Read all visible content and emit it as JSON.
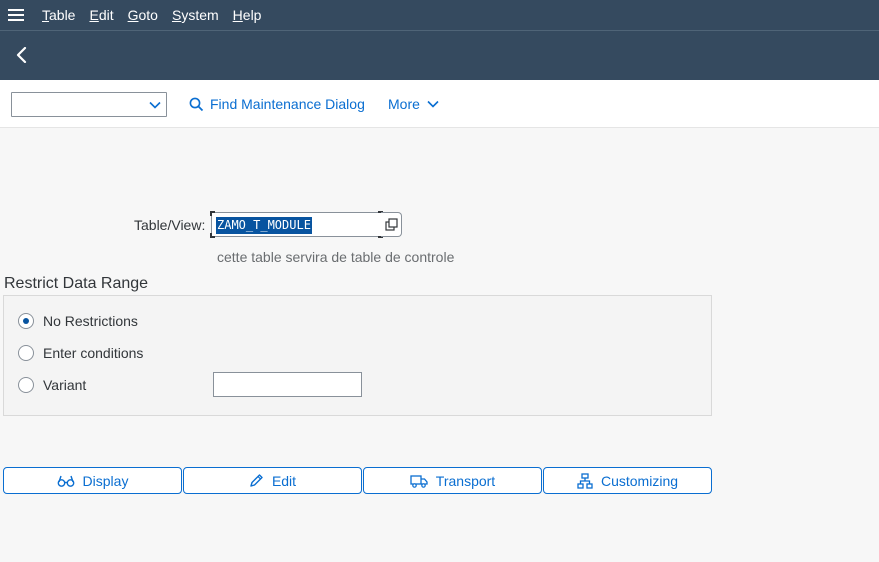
{
  "menu": {
    "items": [
      {
        "first": "T",
        "rest": "able"
      },
      {
        "first": "E",
        "rest": "dit"
      },
      {
        "first": "G",
        "rest": "oto"
      },
      {
        "first": "S",
        "rest": "ystem"
      },
      {
        "first": "H",
        "rest": "elp"
      }
    ]
  },
  "toolbar": {
    "dropdown_value": "",
    "find_label": "Find Maintenance Dialog",
    "more_label": "More"
  },
  "form": {
    "table_label": "Table/View:",
    "table_value": "ZAMO_T_MODULE",
    "table_description": "cette table servira de table de controle"
  },
  "restrict": {
    "title": "Restrict Data Range",
    "options": [
      {
        "label": "No Restrictions",
        "checked": true
      },
      {
        "label": "Enter conditions",
        "checked": false
      },
      {
        "label": "Variant",
        "checked": false
      }
    ],
    "variant_value": ""
  },
  "actions": {
    "display": "Display",
    "edit": "Edit",
    "transport": "Transport",
    "customizing": "Customizing"
  },
  "colors": {
    "header": "#354a5f",
    "accent": "#0a6ed1",
    "selection": "#0854a0"
  },
  "icons": [
    "menu-icon",
    "back-icon",
    "chevron-down-icon",
    "search-icon",
    "value-help-icon",
    "glasses-icon",
    "pencil-icon",
    "truck-icon",
    "hierarchy-icon"
  ]
}
